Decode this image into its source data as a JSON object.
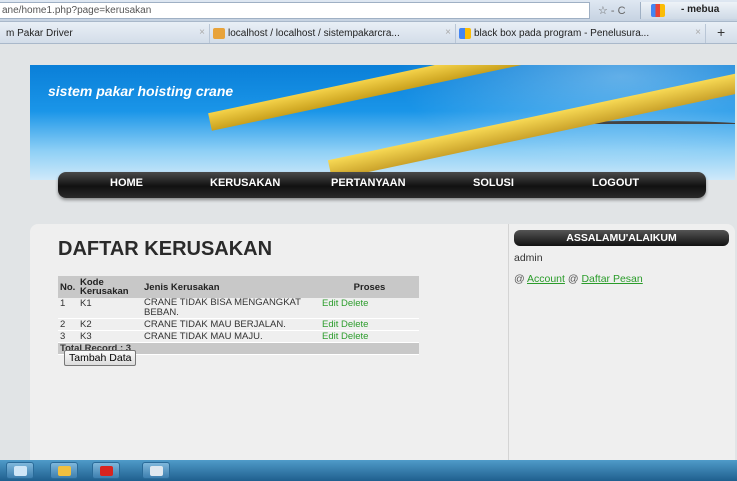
{
  "browser": {
    "url": "ane/home1.php?page=kerusakan",
    "nav_ctl": "☆ - C",
    "ext_label": "- mebua",
    "tabs": [
      {
        "label": "m Pakar Driver",
        "close": "×"
      },
      {
        "label": "localhost / localhost / sistempakarcra...",
        "close": "×"
      },
      {
        "label": "black box pada program - Penelusura...",
        "close": "×"
      }
    ],
    "new_tab": "+"
  },
  "site": {
    "title": "sistem pakar hoisting crane",
    "menu": [
      "HOME",
      "KERUSAKAN",
      "PERTANYAAN",
      "SOLUSI",
      "LOGOUT"
    ]
  },
  "main": {
    "heading": "DAFTAR KERUSAKAN",
    "columns": [
      "No.",
      "Kode Kerusakan",
      "Jenis Kerusakan",
      "Proses"
    ],
    "rows": [
      {
        "no": "1",
        "kode": "K1",
        "jenis": "CRANE TIDAK BISA MENGANGKAT BEBAN.",
        "proses": "Edit Delete"
      },
      {
        "no": "2",
        "kode": "K2",
        "jenis": "CRANE TIDAK MAU BERJALAN.",
        "proses": "Edit Delete"
      },
      {
        "no": "3",
        "kode": "K3",
        "jenis": "CRANE TIDAK MAU MAJU.",
        "proses": "Edit Delete"
      }
    ],
    "total": "Total Record : 3",
    "button": "Tambah Data"
  },
  "sidebar": {
    "greeting": "ASSALAMU'ALAIKUM",
    "user": "admin",
    "at1": "@ ",
    "link1": "Account",
    "at2": " @ ",
    "link2": "Daftar Pesan"
  },
  "colors": {
    "link": "#2a9c2a",
    "menu_bg": "#111111",
    "banner": "#1a95e8"
  }
}
